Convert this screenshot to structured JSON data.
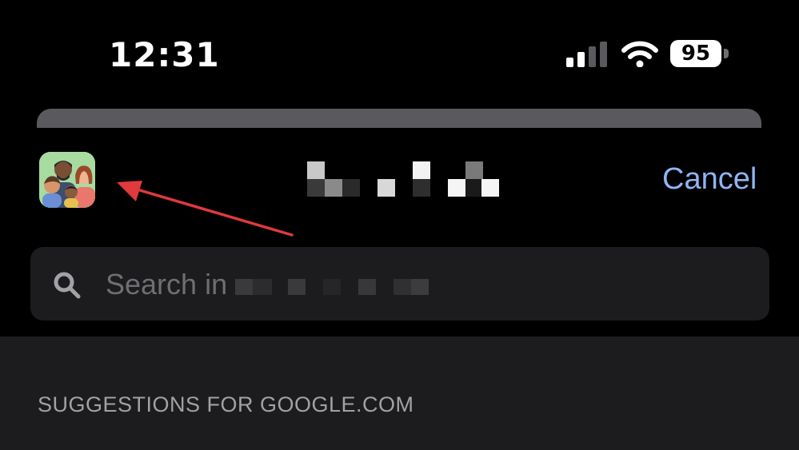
{
  "status_bar": {
    "time": "12:31",
    "battery_level": "95",
    "signal_bars_active": 2,
    "signal_bars_total": 4,
    "icons": [
      "signal-icon",
      "wifi-icon",
      "battery-icon"
    ]
  },
  "share_sheet": {
    "app_icon": "family-app-icon",
    "title_obscured": true,
    "cancel_label": "Cancel"
  },
  "search": {
    "placeholder": "Search in",
    "query_obscured": true,
    "icon": "search-icon"
  },
  "suggestions": {
    "header": "SUGGESTIONS FOR GOOGLE.COM"
  },
  "colors": {
    "background": "#000000",
    "accent": "#8fb4f2",
    "search_field": "#1c1c1e",
    "secondary_text": "#a1a1a6",
    "annotation_arrow": "#e0393e"
  }
}
